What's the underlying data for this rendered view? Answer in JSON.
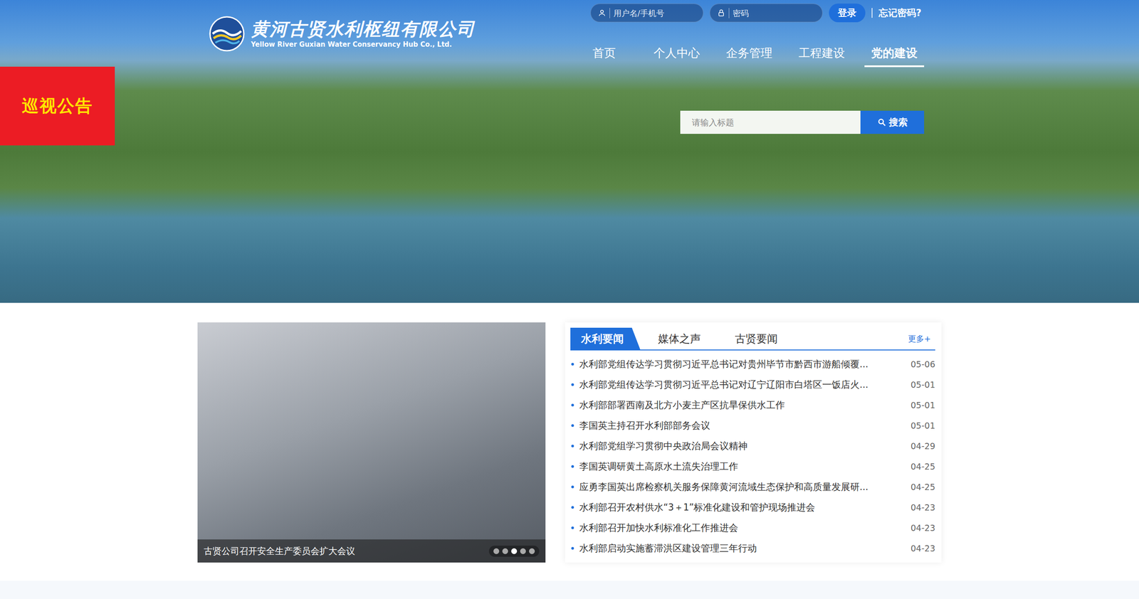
{
  "header": {
    "logo": {
      "title": "黄河古贤水利枢纽有限公司",
      "subtitle": "Yellow River Guxian Water Conservancy Hub Co., Ltd."
    },
    "login": {
      "username_placeholder": "用户名/手机号",
      "password_placeholder": "密码",
      "button": "登录",
      "forgot": "忘记密码?"
    },
    "nav": [
      {
        "label": "首页",
        "selected": false
      },
      {
        "label": "个人中心",
        "selected": false
      },
      {
        "label": "企务管理",
        "selected": false
      },
      {
        "label": "工程建设",
        "selected": false
      },
      {
        "label": "党的建设",
        "selected": true
      }
    ],
    "search": {
      "placeholder": "请输入标题",
      "button": "搜索"
    }
  },
  "notice": "巡视公告",
  "carousel": {
    "caption": "古贤公司召开安全生产委员会扩大会议",
    "dots": [
      {
        "selected": false
      },
      {
        "selected": false
      },
      {
        "selected": true
      },
      {
        "selected": false
      },
      {
        "selected": false
      }
    ]
  },
  "news": {
    "tabs": [
      {
        "label": "水利要闻",
        "selected": true
      },
      {
        "label": "媒体之声",
        "selected": false
      },
      {
        "label": "古贤要闻",
        "selected": false
      }
    ],
    "more": "更多+",
    "items": [
      {
        "title": "水利部党组传达学习贯彻习近平总书记对贵州毕节市黔西市游船倾覆...",
        "date": "05-06"
      },
      {
        "title": "水利部党组传达学习贯彻习近平总书记对辽宁辽阳市白塔区一饭店火...",
        "date": "05-01"
      },
      {
        "title": "水利部部署西南及北方小麦主产区抗旱保供水工作",
        "date": "05-01"
      },
      {
        "title": "李国英主持召开水利部部务会议",
        "date": "05-01"
      },
      {
        "title": "水利部党组学习贯彻中央政治局会议精神",
        "date": "04-29"
      },
      {
        "title": "李国英调研黄土高原水土流失治理工作",
        "date": "04-25"
      },
      {
        "title": "应勇李国英出席检察机关服务保障黄河流域生态保护和高质量发展研...",
        "date": "04-25"
      },
      {
        "title": "水利部召开农村供水“3＋1”标准化建设和管护现场推进会",
        "date": "04-23"
      },
      {
        "title": "水利部召开加快水利标准化工作推进会",
        "date": "04-23"
      },
      {
        "title": "水利部启动实施蓄滞洪区建设管理三年行动",
        "date": "04-23"
      }
    ]
  }
}
